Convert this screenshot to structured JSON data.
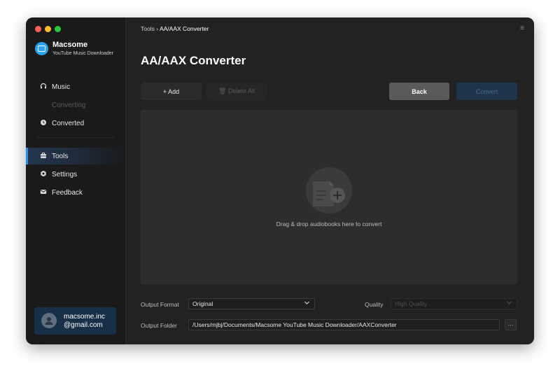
{
  "app": {
    "name": "Macsome",
    "subtitle": "YouTube Music Downloader"
  },
  "sidebar": {
    "items": [
      {
        "label": "Music",
        "icon": "headphones-icon",
        "state": "normal"
      },
      {
        "label": "Converting",
        "icon": "converting-icon",
        "state": "disabled"
      },
      {
        "label": "Converted",
        "icon": "clock-icon",
        "state": "normal"
      },
      {
        "label": "Tools",
        "icon": "toolbox-icon",
        "state": "active"
      },
      {
        "label": "Settings",
        "icon": "gear-icon",
        "state": "normal"
      },
      {
        "label": "Feedback",
        "icon": "mail-icon",
        "state": "normal"
      }
    ],
    "user": {
      "line1": "macsome.inc",
      "line2": "@gmail.com"
    }
  },
  "header": {
    "breadcrumb_root": "Tools",
    "breadcrumb_sep": "›",
    "breadcrumb_current": "AA/AAX Converter",
    "menu_icon": "≡"
  },
  "main": {
    "title": "AA/AAX Converter",
    "add_label": "+ Add",
    "delete_all_label": "🗑 Delete All",
    "back_label": "Back",
    "convert_label": "Convert",
    "drop_text": "Drag & drop audiobooks here to convert",
    "output_format_label": "Output Format",
    "output_format_value": "Original",
    "quality_label": "Quality",
    "quality_value": "High Quality",
    "output_folder_label": "Output Folder",
    "output_folder_value": "/Users/mjbj/Documents/Macsome YouTube Music Downloader/AAXConverter",
    "browse_label": "···"
  },
  "colors": {
    "accent": "#2f8fe8",
    "logo": "#2aa3f0",
    "active_nav": "#23374f",
    "user_card": "#173048"
  }
}
